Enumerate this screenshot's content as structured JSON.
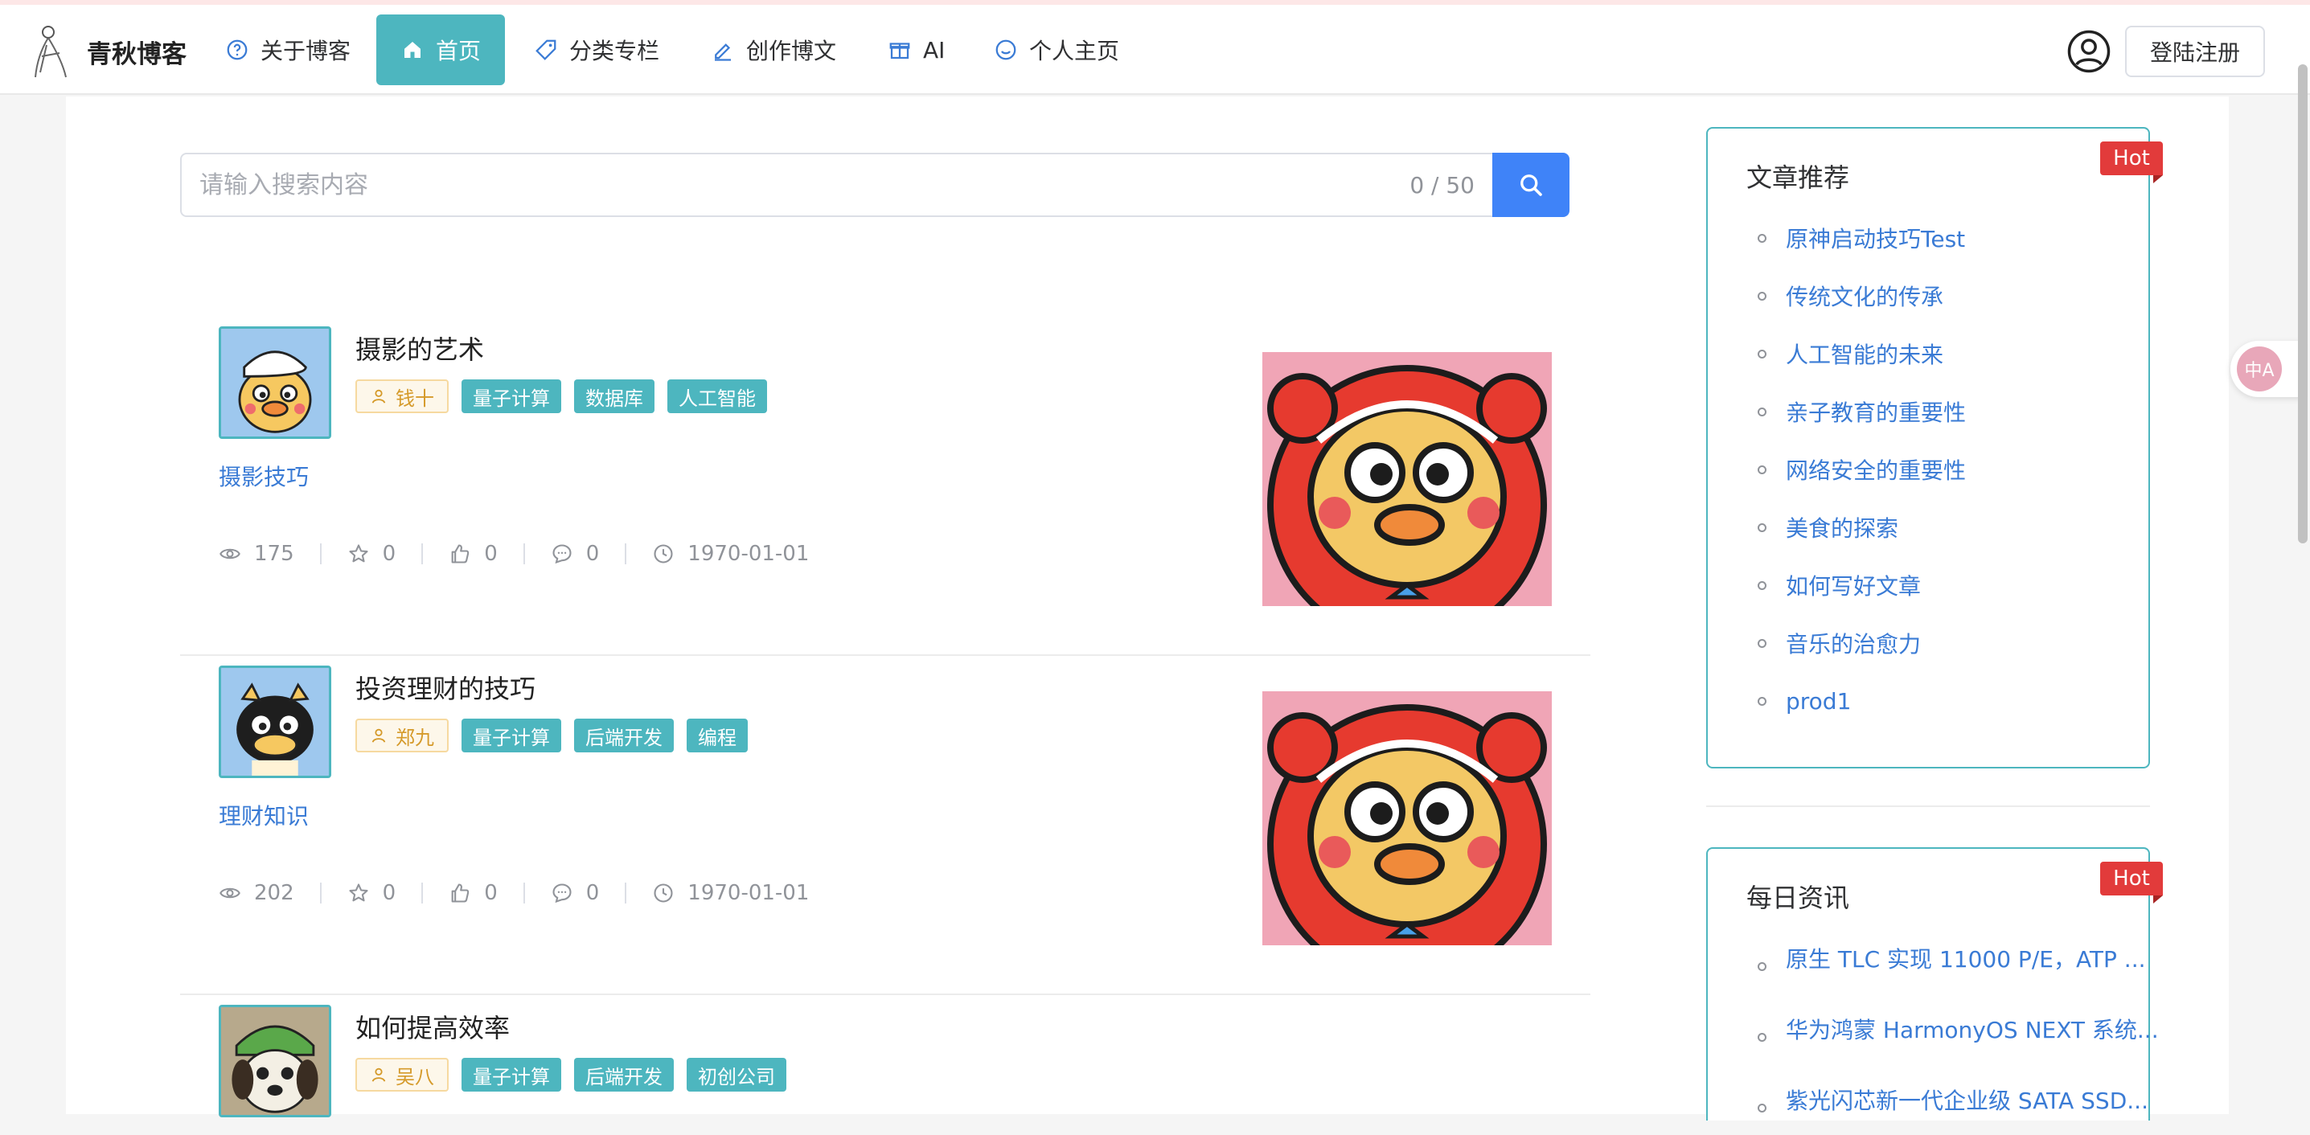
{
  "header": {
    "brand": "青秋博客",
    "nav": [
      {
        "label": "关于博客",
        "icon": "question-circle-icon"
      },
      {
        "label": "首页",
        "icon": "home-icon",
        "active": true
      },
      {
        "label": "分类专栏",
        "icon": "tag-icon"
      },
      {
        "label": "创作博文",
        "icon": "edit-icon"
      },
      {
        "label": "AI",
        "icon": "gift-icon"
      },
      {
        "label": "个人主页",
        "icon": "smile-icon"
      }
    ],
    "login_label": "登陆注册"
  },
  "search": {
    "placeholder": "请输入搜索内容",
    "value": "",
    "count": "0 / 50"
  },
  "articles": [
    {
      "title": "摄影的艺术",
      "author": "钱十",
      "tags": [
        "量子计算",
        "数据库",
        "人工智能"
      ],
      "category": "摄影技巧",
      "views": "175",
      "stars": "0",
      "likes": "0",
      "comments": "0",
      "date": "1970-01-01"
    },
    {
      "title": "投资理财的技巧",
      "author": "郑九",
      "tags": [
        "量子计算",
        "后端开发",
        "编程"
      ],
      "category": "理财知识",
      "views": "202",
      "stars": "0",
      "likes": "0",
      "comments": "0",
      "date": "1970-01-01"
    },
    {
      "title": "如何提高效率",
      "author": "吴八",
      "tags": [
        "量子计算",
        "后端开发",
        "初创公司"
      ]
    }
  ],
  "sidebar": {
    "recommend": {
      "title": "文章推荐",
      "badge": "Hot",
      "items": [
        "原神启动技巧Test",
        "传统文化的传承",
        "人工智能的未来",
        "亲子教育的重要性",
        "网络安全的重要性",
        "美食的探索",
        "如何写好文章",
        "音乐的治愈力",
        "prod1"
      ]
    },
    "news": {
      "title": "每日资讯",
      "badge": "Hot",
      "items": [
        "原生 TLC 实现 11000 P/E，ATP ...",
        "华为鸿蒙 HarmonyOS NEXT 系统...",
        "紫光闪芯新一代企业级 SATA SSD..."
      ]
    }
  },
  "translate_label": "中A",
  "colors": {
    "accent": "#4db6bf",
    "link": "#3a7bd5",
    "search_button": "#3f83f8",
    "hot_badge": "#e23b3b"
  }
}
